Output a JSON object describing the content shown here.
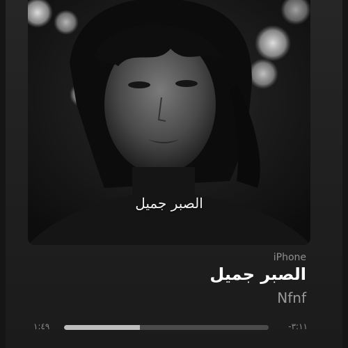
{
  "artwork": {
    "caption": "الصبر جميل"
  },
  "now_playing": {
    "source": "iPhone",
    "title": "الصبر جميل",
    "artist": "Nfnf"
  },
  "playback": {
    "elapsed": "١:٤٩",
    "remaining": "-٣:١١",
    "progress": 0.37
  }
}
